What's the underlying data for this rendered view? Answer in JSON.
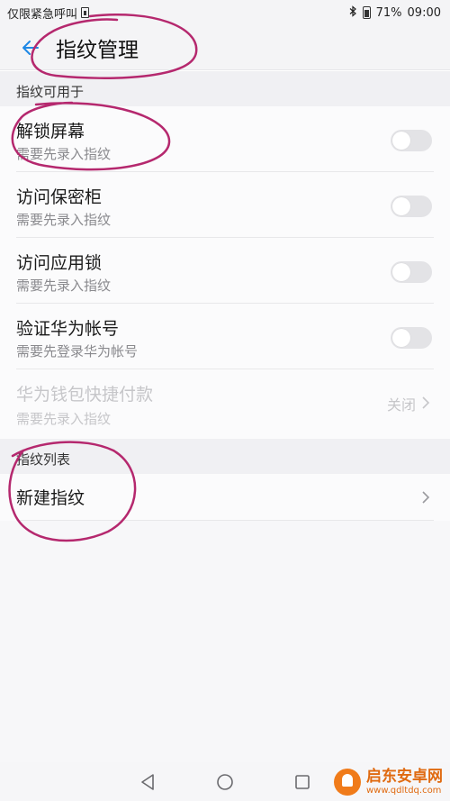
{
  "status_bar": {
    "left_text": "仅限紧急呼叫",
    "battery_percent": "71%",
    "time": "09:00"
  },
  "app_bar": {
    "title": "指纹管理"
  },
  "sections": {
    "usage_header": "指纹可用于",
    "list_header": "指纹列表"
  },
  "usage_items": [
    {
      "title": "解锁屏幕",
      "subtitle": "需要先录入指纹",
      "toggle_on": false
    },
    {
      "title": "访问保密柜",
      "subtitle": "需要先录入指纹",
      "toggle_on": false
    },
    {
      "title": "访问应用锁",
      "subtitle": "需要先录入指纹",
      "toggle_on": false
    },
    {
      "title": "验证华为帐号",
      "subtitle": "需要先登录华为帐号",
      "toggle_on": false
    },
    {
      "title": "华为钱包快捷付款",
      "subtitle": "需要先录入指纹",
      "value": "关闭",
      "disabled": true
    }
  ],
  "list_items": [
    {
      "title": "新建指纹"
    }
  ],
  "watermark": {
    "title": "启东安卓网",
    "url": "www.qdltdq.com"
  },
  "colors": {
    "accent": "#1e88e5",
    "annotation": "#b5286e",
    "watermark": "#e06a10"
  }
}
